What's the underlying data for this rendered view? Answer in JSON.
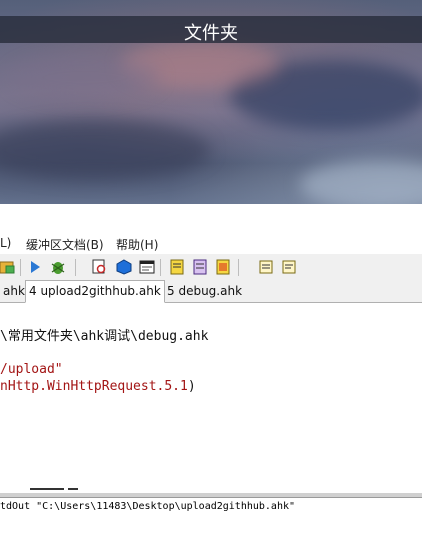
{
  "window": {
    "title": "文件夹"
  },
  "menu": {
    "items": [
      "L)",
      "缓冲区文档(B)",
      "帮助(H)"
    ]
  },
  "toolbar": {
    "icons": [
      "folder-icon",
      "run-icon",
      "debug-icon",
      "search-icon",
      "package-icon",
      "window-icon",
      "note-icon",
      "note-edit-icon",
      "note-list-icon",
      "doc-icon",
      "doc-alt-icon"
    ]
  },
  "tabs": [
    {
      "label": "ahk",
      "active": false
    },
    {
      "label": "4 upload2githhub.ahk",
      "active": true
    },
    {
      "label": "5 debug.ahk",
      "active": false
    }
  ],
  "editor": {
    "lines": [
      {
        "text": "\\常用文件夹\\ahk调试\\debug.ahk",
        "color": "#111111"
      },
      {
        "text": "/upload\"",
        "color": "#a31515"
      },
      {
        "text": "nHttp.WinHttpRequest.5.1",
        "color": "#a31515"
      },
      {
        "text": ")",
        "color": "#111111"
      }
    ]
  },
  "output": {
    "text": "tdOut \"C:\\Users\\11483\\Desktop\\upload2githhub.ahk\""
  },
  "colors": {
    "string": "#a31515",
    "titlebar": "#2b2f3c"
  }
}
